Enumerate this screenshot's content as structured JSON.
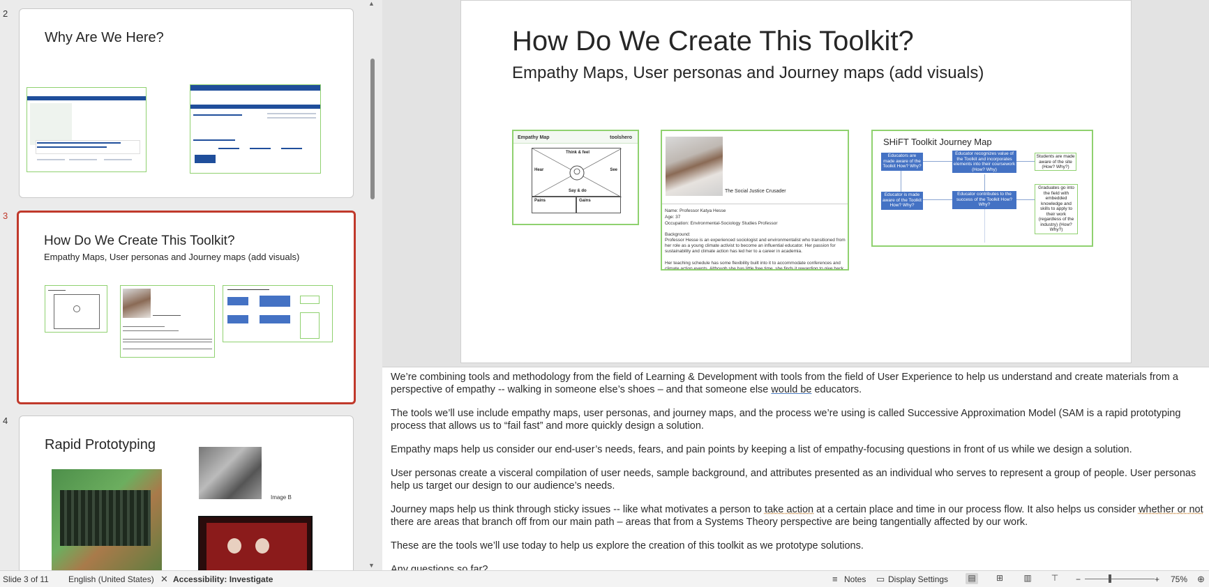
{
  "thumbnails": [
    {
      "number": "2",
      "title": "Why Are We Here?"
    },
    {
      "number": "3",
      "title": "How Do We Create This Toolkit?",
      "subtitle": "Empathy Maps, User personas and Journey maps (add visuals)"
    },
    {
      "number": "4",
      "title": "Rapid Prototyping",
      "image_caption": "Image B"
    }
  ],
  "slide": {
    "title": "How Do We Create This Toolkit?",
    "subtitle": "Empathy Maps, User personas and Journey maps (add visuals)",
    "empathy_map": {
      "header_left": "Empathy Map",
      "header_right": "toolshero",
      "think_feel": "Think & feel",
      "hear": "Hear",
      "see": "See",
      "say_do": "Say & do",
      "pains": "Pains",
      "gains": "Gains"
    },
    "persona": {
      "tagline": "The Social Justice Crusader",
      "name": "Name: Professor Katya Hesse",
      "age": "Age: 37",
      "occupation": "Occupation: Environmental-Sociology Studies Professor",
      "background_label": "Background:",
      "background": "Professor Hesse is an experienced sociologist and environmentalist who transitioned from her role as a young climate activist to become an influential educator. Her passion for sustainability and climate action has led her to a career in academia.",
      "schedule": "Her teaching schedule has some flexibility built into it to accommodate conferences and climate action events. Although she has little free time, she finds it rewarding to give back"
    },
    "journey_map": {
      "title": "SHiFT Toolkit Journey Map",
      "boxes": [
        "Educators are made aware of the Toolkit How? Why?",
        "Educator recognizes value of the Toolkit and incorporates elements into their coursework (How? Why)",
        "Students are made aware of the site (How? Why?)",
        "Educator is made aware of the Toolkit How? Why?",
        "Educator contributes to the success of the Toolkit How? Why?",
        "Graduates go into the field with embedded knowledge and skills to apply to their work (regardless of the industry) (How? Why?)"
      ]
    }
  },
  "notes": {
    "p1a": "We’re combining tools and methodology from the field of Learning & Development with tools from the field of User Experience to help us understand and create materials from a perspective of empathy -- walking in someone else’s shoes – and that someone else ",
    "p1b": "would be",
    "p1c": " educators.",
    "p2": "The tools we’ll use include empathy maps, user personas, and journey maps, and the process we’re using is called Successive Approximation Model (SAM is a rapid prototyping process that allows us to “fail fast” and more quickly design a solution.",
    "p3": "Empathy maps help us consider our end-user’s needs, fears, and pain points by keeping a list of empathy-focusing questions in front of us while we design a solution.",
    "p4": "User personas create a visceral compilation of user needs, sample background, and attributes presented as an individual who serves to represent a group of people. User personas help us target our design to our audience’s needs.",
    "p5a": "Journey maps help us think through sticky issues --  like what motivates a person to ",
    "p5b": "take action",
    "p5c": " at a certain place and time in our process flow. It also helps us consider ",
    "p5d": "whether or not",
    "p5e": " there are areas that branch off from our main path – areas that from a Systems Theory perspective are being tangentially affected by our work.",
    "p6": "These are the tools we’ll use today to help us explore the creation of this toolkit as we prototype solutions.",
    "p7": "Any questions so far?"
  },
  "status": {
    "slide_count": "Slide 3 of 11",
    "language": "English (United States)",
    "accessibility": "Accessibility: Investigate",
    "notes": "Notes",
    "display_settings": "Display Settings",
    "zoom": "75%"
  }
}
